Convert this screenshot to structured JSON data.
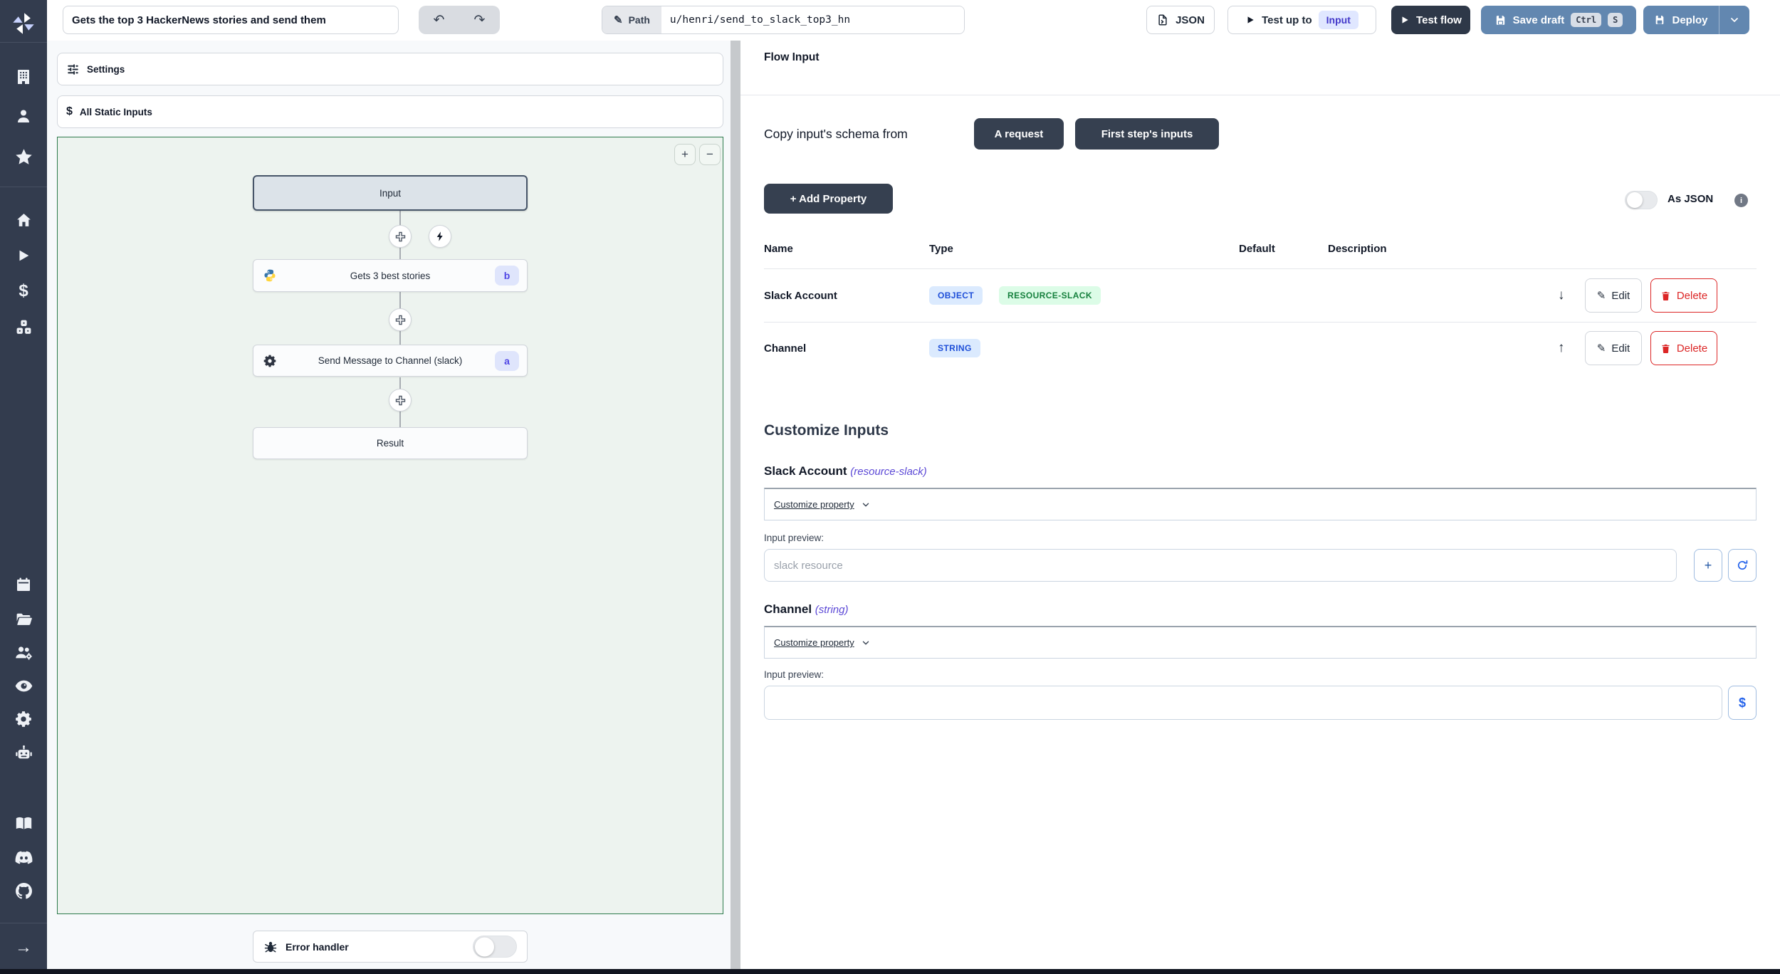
{
  "topbar": {
    "title": "Gets the top 3 HackerNews stories and send them",
    "path_label": "Path",
    "path_value": "u/henri/send_to_slack_top3_hn",
    "json_button": "JSON",
    "test_up_to": "Test up to",
    "test_up_to_target": "Input",
    "test_flow": "Test flow",
    "save_draft": "Save draft",
    "kbd_ctrl": "Ctrl",
    "kbd_s": "S",
    "deploy": "Deploy"
  },
  "left_panel": {
    "settings_label": "Settings",
    "static_inputs_label": "All Static Inputs",
    "error_handler_label": "Error handler",
    "nodes": {
      "input": "Input",
      "step_b_label": "Gets 3 best stories",
      "step_b_badge": "b",
      "step_a_label": "Send Message to Channel (slack)",
      "step_a_badge": "a",
      "result": "Result"
    }
  },
  "flow_input": {
    "title": "Flow Input",
    "copy_schema_label": "Copy input's schema from",
    "copy_request": "A request",
    "copy_first_step": "First step's inputs",
    "add_property": "+ Add Property",
    "as_json_label": "As JSON",
    "table": {
      "headers": [
        "Name",
        "Type",
        "Default",
        "Description"
      ],
      "rows": [
        {
          "name": "Slack Account",
          "badges": [
            "OBJECT",
            "RESOURCE-SLACK"
          ],
          "edit": "Edit",
          "delete": "Delete"
        },
        {
          "name": "Channel",
          "badges": [
            "STRING"
          ],
          "edit": "Edit",
          "delete": "Delete"
        }
      ]
    },
    "customize": {
      "title": "Customize Inputs",
      "sections": [
        {
          "name": "Slack Account",
          "type": "(resource-slack)",
          "dropdown": "Customize property",
          "preview_label": "Input preview:",
          "placeholder": "slack resource"
        },
        {
          "name": "Channel",
          "type": "(string)",
          "dropdown": "Customize property",
          "preview_label": "Input preview:",
          "placeholder": ""
        }
      ]
    }
  },
  "icons": {
    "undo": "↶",
    "redo": "↷",
    "pencil": "✎",
    "dollar": "$",
    "plus": "+",
    "minus": "−",
    "arrow_down": "↓",
    "arrow_up": "↑",
    "arrow_right": "→",
    "info": "i"
  },
  "colors": {
    "sidebar_bg": "#333c4e",
    "dark_button": "#364050",
    "steel_blue_button": "#6287b0",
    "canvas_border": "#2c7a4b",
    "canvas_bg": "#edf3ef",
    "badge_blue_bg": "#dbeafe",
    "badge_blue_text": "#1d4ed8",
    "badge_green_bg": "#dcfce7",
    "badge_green_text": "#15803d",
    "step_badge_bg": "#dfe5fc",
    "step_badge_text": "#4f46e5",
    "input_chip_bg": "#e0e7ff",
    "input_chip_text": "#4338ca",
    "delete_red": "#dc2626"
  }
}
